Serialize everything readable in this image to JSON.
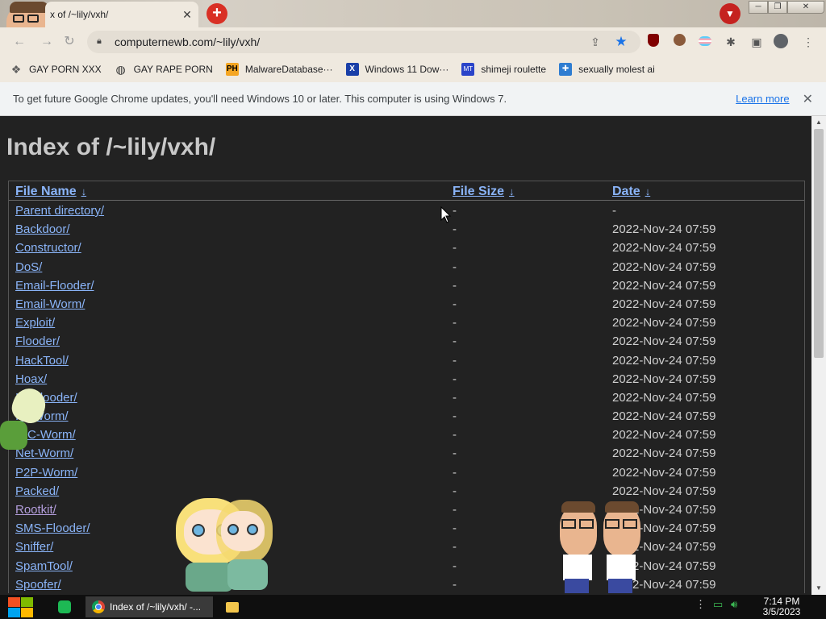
{
  "browser": {
    "tab_title": "x of /~lily/vxh/",
    "new_tab_label": "+",
    "url": "computernewb.com/~lily/vxh/",
    "window_controls": {
      "minimize": "─",
      "maximize": "❐",
      "close": "✕"
    }
  },
  "bookmarks": [
    {
      "label": "GAY PORN XXX",
      "icon": "paw-icon",
      "icon_color": "#5f5f5f"
    },
    {
      "label": "GAY RAPE PORN",
      "icon": "globe-icon",
      "icon_color": "#333333"
    },
    {
      "label": "MalwareDatabase···",
      "icon": "ph-icon",
      "icon_color": "#f5a623"
    },
    {
      "label": "Windows 11 Dow···",
      "icon": "x-icon",
      "icon_color": "#1a3fa8"
    },
    {
      "label": "shimeji roulette",
      "icon": "mt-icon",
      "icon_color": "#2a44c9"
    },
    {
      "label": "sexually molest ai",
      "icon": "puzzle-icon",
      "icon_color": "#2f7dd1"
    }
  ],
  "infobar": {
    "message": "To get future Google Chrome updates, you'll need Windows 10 or later. This computer is using Windows 7.",
    "link": "Learn more",
    "close": "✕"
  },
  "page": {
    "heading": "Index of /~lily/vxh/",
    "columns": {
      "name": "File Name",
      "size": "File Size",
      "date": "Date",
      "sort_arrow": "↓"
    },
    "rows": [
      {
        "name": "Parent directory/",
        "size": "-",
        "date": "-"
      },
      {
        "name": "Backdoor/",
        "size": "-",
        "date": "2022-Nov-24 07:59"
      },
      {
        "name": "Constructor/",
        "size": "-",
        "date": "2022-Nov-24 07:59"
      },
      {
        "name": "DoS/",
        "size": "-",
        "date": "2022-Nov-24 07:59"
      },
      {
        "name": "Email-Flooder/",
        "size": "-",
        "date": "2022-Nov-24 07:59"
      },
      {
        "name": "Email-Worm/",
        "size": "-",
        "date": "2022-Nov-24 07:59"
      },
      {
        "name": "Exploit/",
        "size": "-",
        "date": "2022-Nov-24 07:59"
      },
      {
        "name": "Flooder/",
        "size": "-",
        "date": "2022-Nov-24 07:59"
      },
      {
        "name": "HackTool/",
        "size": "-",
        "date": "2022-Nov-24 07:59"
      },
      {
        "name": "Hoax/",
        "size": "-",
        "date": "2022-Nov-24 07:59"
      },
      {
        "name": "IM-Flooder/",
        "size": "-",
        "date": "2022-Nov-24 07:59"
      },
      {
        "name": "IM-Worm/",
        "size": "-",
        "date": "2022-Nov-24 07:59"
      },
      {
        "name": "IRC-Worm/",
        "size": "-",
        "date": "2022-Nov-24 07:59"
      },
      {
        "name": "Net-Worm/",
        "size": "-",
        "date": "2022-Nov-24 07:59"
      },
      {
        "name": "P2P-Worm/",
        "size": "-",
        "date": "2022-Nov-24 07:59"
      },
      {
        "name": "Packed/",
        "size": "-",
        "date": "2022-Nov-24 07:59"
      },
      {
        "name": "Rootkit/",
        "size": "-",
        "date": "2022-Nov-24 07:59",
        "visited": true
      },
      {
        "name": "SMS-Flooder/",
        "size": "-",
        "date": "2022-Nov-24 07:59"
      },
      {
        "name": "Sniffer/",
        "size": "-",
        "date": "2022-Nov-24 07:59"
      },
      {
        "name": "SpamTool/",
        "size": "-",
        "date": "2022-Nov-24 07:59"
      },
      {
        "name": "Spoofer/",
        "size": "-",
        "date": "2022-Nov-24 07:59"
      }
    ]
  },
  "taskbar": {
    "chrome_item": "Index of /~lily/vxh/ -...",
    "time": "7:14 PM",
    "date": "3/5/2023"
  }
}
